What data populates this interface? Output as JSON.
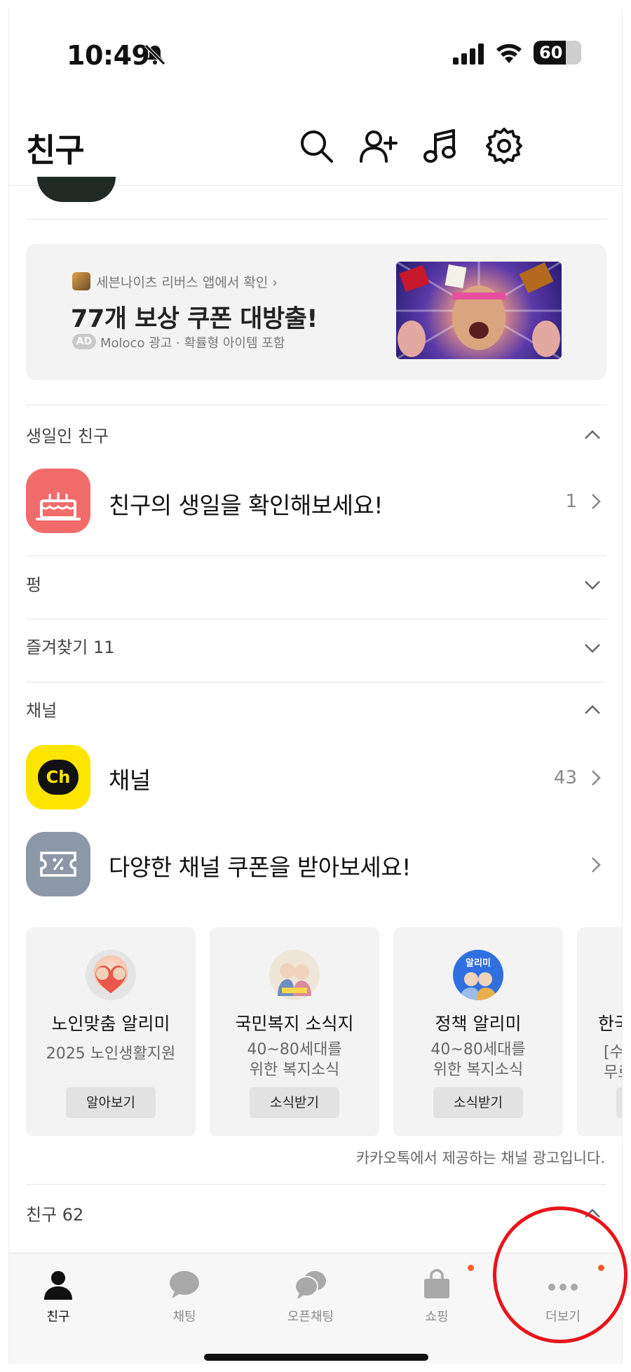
{
  "status_bar": {
    "time": "10:49",
    "battery": "60"
  },
  "header": {
    "title": "친구"
  },
  "ad": {
    "source": "세븐나이츠 리버스 앱에서 확인 ›",
    "title": "77개 보상 쿠폰 대방출!",
    "badge": "AD",
    "meta": "Moloco 광고 · 확률형 아이템 포함"
  },
  "birthday": {
    "section": "생일인 친구",
    "text": "친구의 생일을 확인해보세요!",
    "count": "1"
  },
  "pung": {
    "section": "펑"
  },
  "favorites": {
    "section": "즐겨찾기 11"
  },
  "channel": {
    "section": "채널",
    "row_label": "채널",
    "row_count": "43",
    "logo_text": "Ch",
    "coupon_text": "다양한 채널 쿠폰을 받아보세요!"
  },
  "cards": [
    {
      "name": "노인맞춤 알리미",
      "desc1": "2025 노인생활지원",
      "desc2": "",
      "button": "알아보기"
    },
    {
      "name": "국민복지 소식지",
      "desc1": "40~80세대를",
      "desc2": "위한 복지소식",
      "button": "소식받기"
    },
    {
      "name": "정책 알리미",
      "desc1": "40~80세대를",
      "desc2": "위한 복지소식",
      "button": "소식받기",
      "badge": "알리미"
    },
    {
      "name": "한국",
      "desc1": "[수",
      "desc2": "무료",
      "button": ""
    }
  ],
  "ad_note": "카카오톡에서 제공하는 채널 광고입니다.",
  "friends": {
    "section": "친구 62"
  },
  "tabs": [
    {
      "label": "친구",
      "icon": "person-icon",
      "active": true
    },
    {
      "label": "채팅",
      "icon": "chat-bubble-icon"
    },
    {
      "label": "오픈채팅",
      "icon": "open-chat-icon"
    },
    {
      "label": "쇼핑",
      "icon": "shopping-bag-icon",
      "new": true
    },
    {
      "label": "더보기",
      "icon": "more-dots-icon",
      "new": true
    }
  ],
  "colors": {
    "accent_red": "#f26b6b",
    "kakao_yellow": "#fee500",
    "dot": "#ff5a2a",
    "annotation": "#e8141c"
  }
}
